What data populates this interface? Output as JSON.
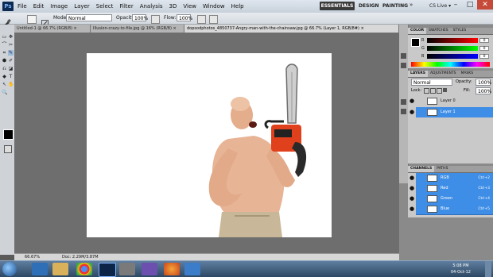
{
  "menubar": {
    "app_logo": "Ps",
    "items": [
      "File",
      "Edit",
      "Image",
      "Layer",
      "Select",
      "Filter",
      "Analysis",
      "3D",
      "View",
      "Window",
      "Help"
    ],
    "workspaces": {
      "essentials": "ESSENTIALS",
      "design": "DESIGN",
      "painting": "PAINTING",
      "more": "»"
    },
    "cs_live": "CS Live ▾",
    "window_controls": {
      "minimize": "–",
      "maximize": "□",
      "close": "✕"
    }
  },
  "options": {
    "mode_label": "Mode:",
    "mode_value": "Normal",
    "opacity_label": "Opacity:",
    "opacity_value": "100%",
    "flow_label": "Flow:",
    "flow_value": "100%"
  },
  "tabs": [
    {
      "label": "Untitled-1 @ 66.7% (RGB/8) ×"
    },
    {
      "label": "Illusion-crazy-to-file.jpg @ 16% (RGB/8) ×"
    },
    {
      "label": "dopsodphotos_4850737-Angry-man-with-the-chainsaw.jpg @ 66.7% (Layer 1, RGB/8#) ×"
    }
  ],
  "tools": [
    "▭",
    "✥",
    "⌒",
    "✂",
    "⌗",
    "✎",
    "⬢",
    "✐",
    "⎌",
    "◪",
    "◆",
    "T",
    "↖",
    "✋",
    "🔍"
  ],
  "status": {
    "zoom": "66.67%",
    "doc": "Doc: 2.29M/3.87M"
  },
  "color_panel": {
    "tabs": [
      "COLOR",
      "SWATCHES",
      "STYLES"
    ],
    "r_label": "R",
    "g_label": "G",
    "b_label": "B",
    "r_value": "0",
    "g_value": "0",
    "b_value": "0"
  },
  "layers_panel": {
    "tabs": [
      "LAYERS",
      "ADJUSTMENTS",
      "MASKS"
    ],
    "blend_mode": "Normal",
    "opacity_label": "Opacity:",
    "opacity_value": "100%",
    "lock_label": "Lock:",
    "fill_label": "Fill:",
    "fill_value": "100%",
    "layers": [
      {
        "name": "Layer 0",
        "selected": false
      },
      {
        "name": "Layer 1",
        "selected": true
      }
    ]
  },
  "channels_panel": {
    "tabs": [
      "CHANNELS",
      "PATHS"
    ],
    "channels": [
      {
        "name": "RGB",
        "shortcut": "Ctrl+2"
      },
      {
        "name": "Red",
        "shortcut": "Ctrl+3"
      },
      {
        "name": "Green",
        "shortcut": "Ctrl+4"
      },
      {
        "name": "Blue",
        "shortcut": "Ctrl+5"
      }
    ]
  },
  "taskbar": {
    "time": "5:08 PM",
    "date": "04-Oct-12"
  },
  "colors": {
    "selection_blue": "#3e8de6",
    "workspace_gray": "#6e6e6e",
    "chainsaw_orange": "#e0411c"
  }
}
